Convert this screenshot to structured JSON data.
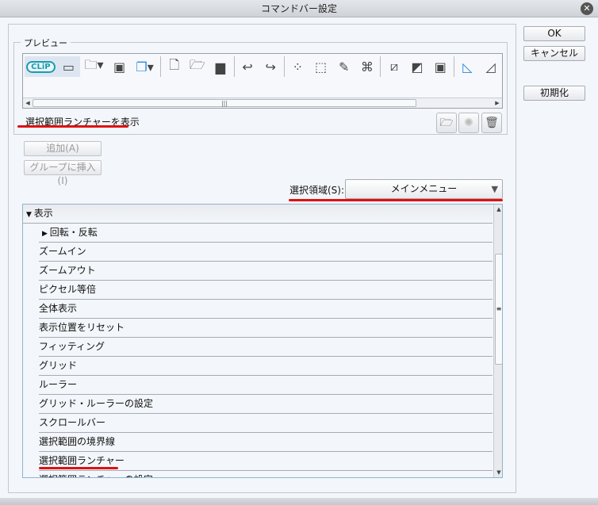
{
  "title": "コマンドバー設定",
  "preview": {
    "label": "プレビュー",
    "description": "選択範囲ランチャーを表示",
    "toolbar_icons": [
      "clip-studio-logo",
      "selection-launcher",
      "open-folder-dropdown",
      "window-layout",
      "duplicate-dropdown",
      "new-file",
      "open-file",
      "save",
      "undo",
      "redo",
      "selection-dots",
      "transform",
      "fill-bucket",
      "warp-transform",
      "clear-outside",
      "fill",
      "border",
      "ruler",
      "curve-ruler"
    ]
  },
  "buttons": {
    "add": "追加(A)",
    "insert_group": "グループに挿入(I)",
    "ok": "OK",
    "cancel": "キャンセル",
    "reset": "初期化"
  },
  "region": {
    "label": "選択領域(S):",
    "value": "メインメニュー"
  },
  "list": {
    "items": [
      {
        "label": "表示",
        "type": "expanded-group"
      },
      {
        "label": "回転・反転",
        "type": "collapsed-group"
      },
      {
        "label": "ズームイン"
      },
      {
        "label": "ズームアウト"
      },
      {
        "label": "ピクセル等倍"
      },
      {
        "label": "全体表示"
      },
      {
        "label": "表示位置をリセット"
      },
      {
        "label": "フィッティング"
      },
      {
        "label": "グリッド"
      },
      {
        "label": "ルーラー"
      },
      {
        "label": "グリッド・ルーラーの設定"
      },
      {
        "label": "スクロールバー"
      },
      {
        "label": "選択範囲の境界線"
      },
      {
        "label": "選択範囲ランチャー",
        "highlighted": true
      },
      {
        "label": "選択範囲ランチャーの設定"
      }
    ]
  },
  "colors": {
    "highlight": "#e01010",
    "logo": "#1b9bb0"
  }
}
